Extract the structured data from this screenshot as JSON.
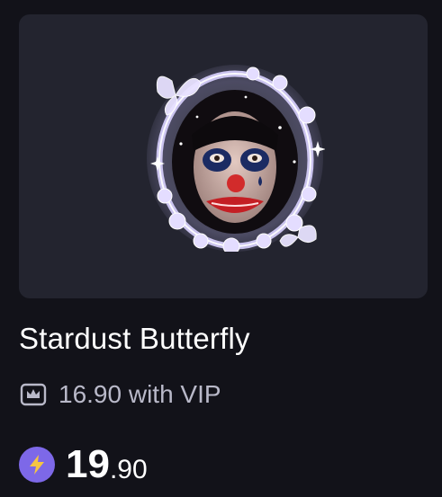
{
  "product": {
    "title": "Stardust Butterfly",
    "vip_price_text": "16.90 with VIP",
    "price_integer": "19",
    "price_decimal": ".90",
    "preview_image": "avatar-frame-stardust-butterfly",
    "vip_icon": "crown-icon",
    "currency_icon": "lightning-coin-icon"
  },
  "colors": {
    "background": "#121219",
    "panel": "#23242f",
    "title": "#ffffff",
    "vip_text": "#b9b9c9",
    "coin": "#7d68e8",
    "coin_bolt": "#f5c542",
    "frame_glow": "#d9d2ff"
  }
}
